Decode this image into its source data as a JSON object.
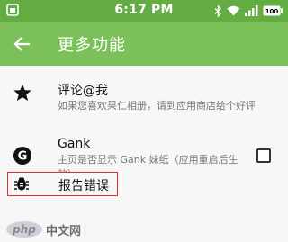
{
  "status_bar": {
    "time": "6:17 PM",
    "battery": "100",
    "icons": [
      "app-icon",
      "bluetooth-icon",
      "wifi-icon",
      "signal-icon",
      "battery-icon"
    ]
  },
  "toolbar": {
    "title": "更多功能",
    "back_icon": "arrow-back-icon"
  },
  "settings": [
    {
      "icon": "star-icon",
      "title": "评论@我",
      "subtitle": "如果您喜欢果仁相册，请到应用商店给个好评"
    },
    {
      "icon": "g-circle-icon",
      "title": "Gank",
      "subtitle": "主页是否显示 Gank 妹纸（应用重启后生效）",
      "checked": false
    },
    {
      "icon": "bug-icon",
      "title": "报告错误"
    }
  ],
  "watermark": {
    "text": "中文网",
    "logo": "php"
  },
  "colors": {
    "status_bar": "#64ad42",
    "toolbar": "#7cc05a",
    "background": "#f7f7f7",
    "highlight_border": "#e0322a"
  }
}
